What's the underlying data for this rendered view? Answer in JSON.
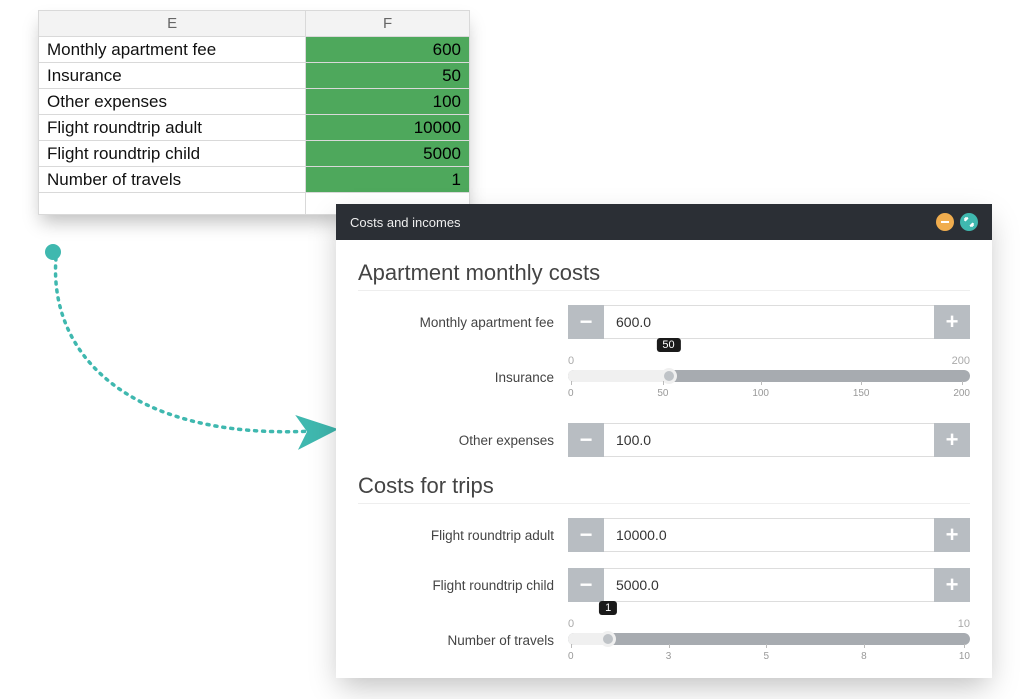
{
  "spreadsheet": {
    "headers": {
      "col1": "E",
      "col2": "F"
    },
    "rows": [
      {
        "label": "Monthly apartment fee",
        "value": "600"
      },
      {
        "label": "Insurance",
        "value": "50"
      },
      {
        "label": "Other expenses",
        "value": "100"
      },
      {
        "label": "Flight roundtrip adult",
        "value": "10000"
      },
      {
        "label": "Flight roundtrip child",
        "value": "5000"
      },
      {
        "label": "Number of travels",
        "value": "1"
      }
    ],
    "highlight_color": "#4ea85c"
  },
  "panel": {
    "title": "Costs and incomes",
    "sections": {
      "apartment": {
        "heading": "Apartment monthly costs",
        "monthly_fee": {
          "label": "Monthly apartment fee",
          "value": "600.0"
        },
        "insurance": {
          "label": "Insurance",
          "min": "0",
          "max": "200",
          "value": "50",
          "ticks": [
            "0",
            "50",
            "100",
            "150",
            "200"
          ],
          "pct": 25
        },
        "other": {
          "label": "Other expenses",
          "value": "100.0"
        }
      },
      "trips": {
        "heading": "Costs for trips",
        "flight_adult": {
          "label": "Flight roundtrip adult",
          "value": "10000.0"
        },
        "flight_child": {
          "label": "Flight roundtrip child",
          "value": "5000.0"
        },
        "num_travels": {
          "label": "Number of travels",
          "min": "0",
          "max": "10",
          "value": "1",
          "ticks": [
            "0",
            "3",
            "5",
            "8",
            "10"
          ],
          "pct": 10
        }
      }
    },
    "titlebar_buttons": {
      "minimize_color": "#f0ad4e",
      "expand_color": "#3fb8af"
    }
  },
  "arrow_color": "#3fb8af"
}
